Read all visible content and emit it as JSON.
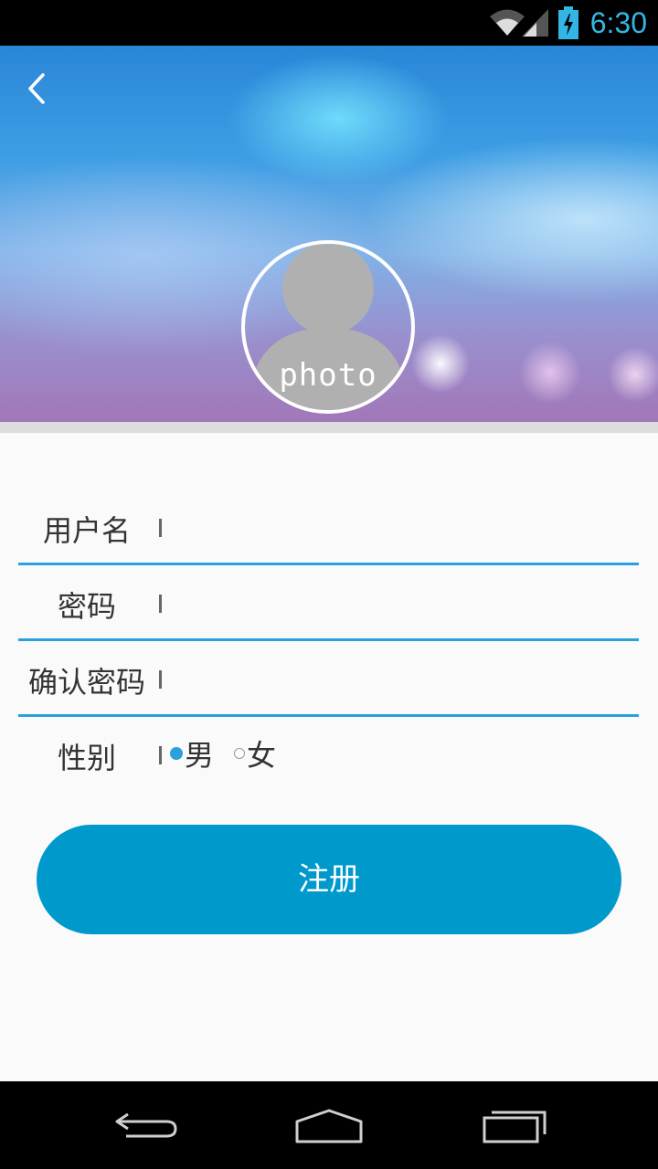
{
  "status_bar": {
    "time": "6:30",
    "icons": [
      "wifi-icon",
      "signal-icon",
      "battery-charging-icon"
    ],
    "accent_color": "#33b5e5"
  },
  "header": {
    "back_icon": "chevron-left-icon",
    "avatar_label": "photo"
  },
  "form": {
    "fields": [
      {
        "label": "用户名",
        "value": ""
      },
      {
        "label": "密码",
        "value": ""
      },
      {
        "label": "确认密码",
        "value": ""
      }
    ],
    "gender": {
      "label": "性别",
      "options": [
        {
          "label": "男",
          "selected": true
        },
        {
          "label": "女",
          "selected": false
        }
      ]
    },
    "submit_label": "注册",
    "accent_color": "#0099cc",
    "underline_color": "#2aa0dc"
  },
  "nav_bar": {
    "icons": [
      "back-nav-icon",
      "home-nav-icon",
      "recents-nav-icon"
    ]
  }
}
